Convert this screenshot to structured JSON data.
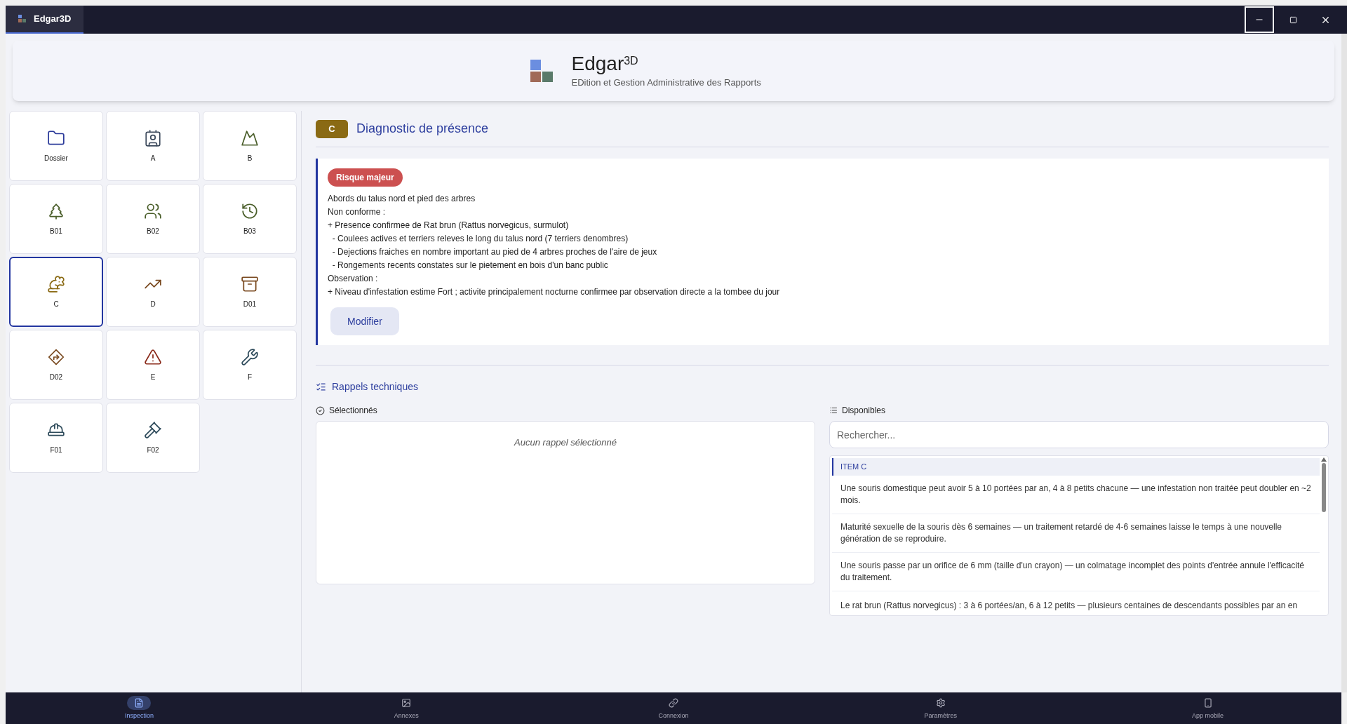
{
  "window": {
    "tab_title": "Edgar3D"
  },
  "header": {
    "app_name": "Edgar",
    "app_name_sup": "3D",
    "subtitle": "EDition et Gestion Administrative des Rapports"
  },
  "tiles": [
    {
      "label": "Dossier",
      "color": "#2b3a9a",
      "selected": false
    },
    {
      "label": "A",
      "color": "#3d4a5c",
      "selected": false
    },
    {
      "label": "B",
      "color": "#4a5e2a",
      "selected": false
    },
    {
      "label": "B01",
      "color": "#4a5e2a",
      "selected": false
    },
    {
      "label": "B02",
      "color": "#4a5e2a",
      "selected": false
    },
    {
      "label": "B03",
      "color": "#4a5e2a",
      "selected": false
    },
    {
      "label": "C",
      "color": "#8a6a14",
      "selected": true
    },
    {
      "label": "D",
      "color": "#7a4a20",
      "selected": false
    },
    {
      "label": "D01",
      "color": "#7a4a20",
      "selected": false
    },
    {
      "label": "D02",
      "color": "#7a4a20",
      "selected": false
    },
    {
      "label": "E",
      "color": "#8a2a1a",
      "selected": false
    },
    {
      "label": "F",
      "color": "#2d4a5a",
      "selected": false
    },
    {
      "label": "F01",
      "color": "#2d4a5a",
      "selected": false
    },
    {
      "label": "F02",
      "color": "#2d4a5a",
      "selected": false
    }
  ],
  "section": {
    "code": "C",
    "title": "Diagnostic de présence"
  },
  "finding": {
    "badge": "Risque majeur",
    "lines": [
      "Abords du talus nord et pied des arbres",
      "Non conforme :",
      "+ Presence confirmee de Rat brun (Rattus norvegicus, surmulot)",
      "  - Coulees actives et terriers releves le long du talus nord (7 terriers denombres)",
      "  - Dejections fraiches en nombre important au pied de 4 arbres proches de l'aire de jeux",
      "  - Rongements recents constates sur le pietement en bois d'un banc public",
      "Observation :",
      "+ Niveau d'infestation estime Fort ; activite principalement nocturne confirmee par observation directe a la tombee du jour"
    ],
    "button": "Modifier"
  },
  "reminders": {
    "title": "Rappels techniques",
    "selected_label": "Sélectionnés",
    "empty_text": "Aucun rappel sélectionné",
    "available_label": "Disponibles",
    "search": {
      "placeholder": "Rechercher..."
    },
    "group": "ITEM C",
    "items": [
      "Une souris domestique peut avoir 5 à 10 portées par an, 4 à 8 petits chacune — une infestation non traitée peut doubler en ~2 mois.",
      "Maturité sexuelle de la souris dès 6 semaines — un traitement retardé de 4-6 semaines laisse le temps à une nouvelle génération de se reproduire.",
      "Une souris passe par un orifice de 6 mm (taille d'un crayon) — un colmatage incomplet des points d'entrée annule l'efficacité du traitement.",
      "Le rat brun (Rattus norvegicus) : 3 à 6 portées/an, 6 à 12 petits — plusieurs centaines de descendants possibles par an en"
    ]
  },
  "bottom_nav": [
    {
      "label": "Inspection",
      "selected": true
    },
    {
      "label": "Annexes",
      "selected": false
    },
    {
      "label": "Connexion",
      "selected": false
    },
    {
      "label": "Paramètres",
      "selected": false
    },
    {
      "label": "App mobile",
      "selected": false
    }
  ]
}
